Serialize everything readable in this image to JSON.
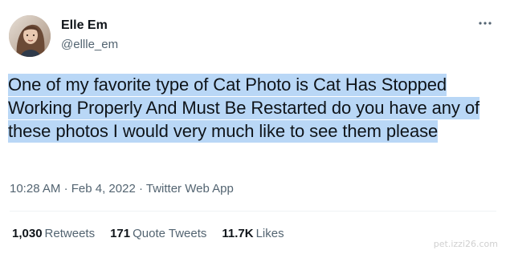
{
  "author": {
    "display_name": "Elle Em",
    "handle": "@ellle_em"
  },
  "tweet": {
    "text": "One of my favorite type of Cat Photo is Cat Has Stopped Working Properly And Must Be Restarted do you have any of these photos I would very much like to see them please",
    "time": "10:28 AM",
    "date": "Feb 4, 2022",
    "source": "Twitter Web App",
    "separator": "·"
  },
  "stats": {
    "retweets_count": "1,030",
    "retweets_label": "Retweets",
    "quote_count": "171",
    "quote_label": "Quote Tweets",
    "likes_count": "11.7K",
    "likes_label": "Likes"
  },
  "watermark": "pet.izzi26.com",
  "colors": {
    "text_primary": "#0f1419",
    "text_secondary": "#536471",
    "selection_highlight": "#b9d7f6",
    "divider": "#eff3f4"
  },
  "icons": {
    "more": "more-horizontal-icon"
  }
}
